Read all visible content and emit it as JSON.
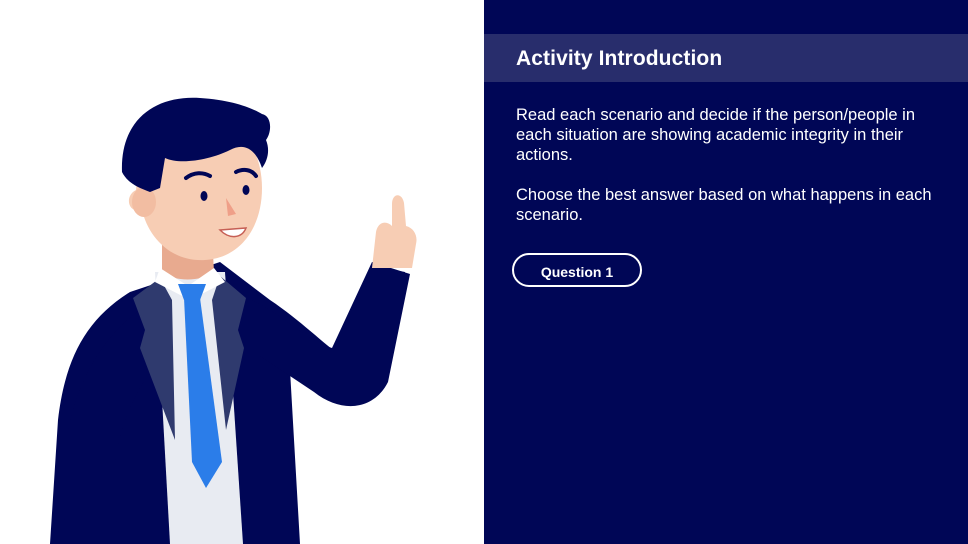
{
  "slide": {
    "title": "Activity Introduction",
    "paragraphs": [
      "Read each scenario and decide if the person/people in each situation are showing academic integrity in their actions.",
      "Choose the best answer based on what happens in each scenario."
    ],
    "button_label": "Question 1"
  },
  "colors": {
    "panel_background": "#000656",
    "title_bar": "#282d6c",
    "text": "#ffffff",
    "tie": "#2b7de9",
    "suit": "#000656",
    "skin": "#f7cdb4"
  },
  "illustration": {
    "name": "pointing-businessman-illustration"
  }
}
